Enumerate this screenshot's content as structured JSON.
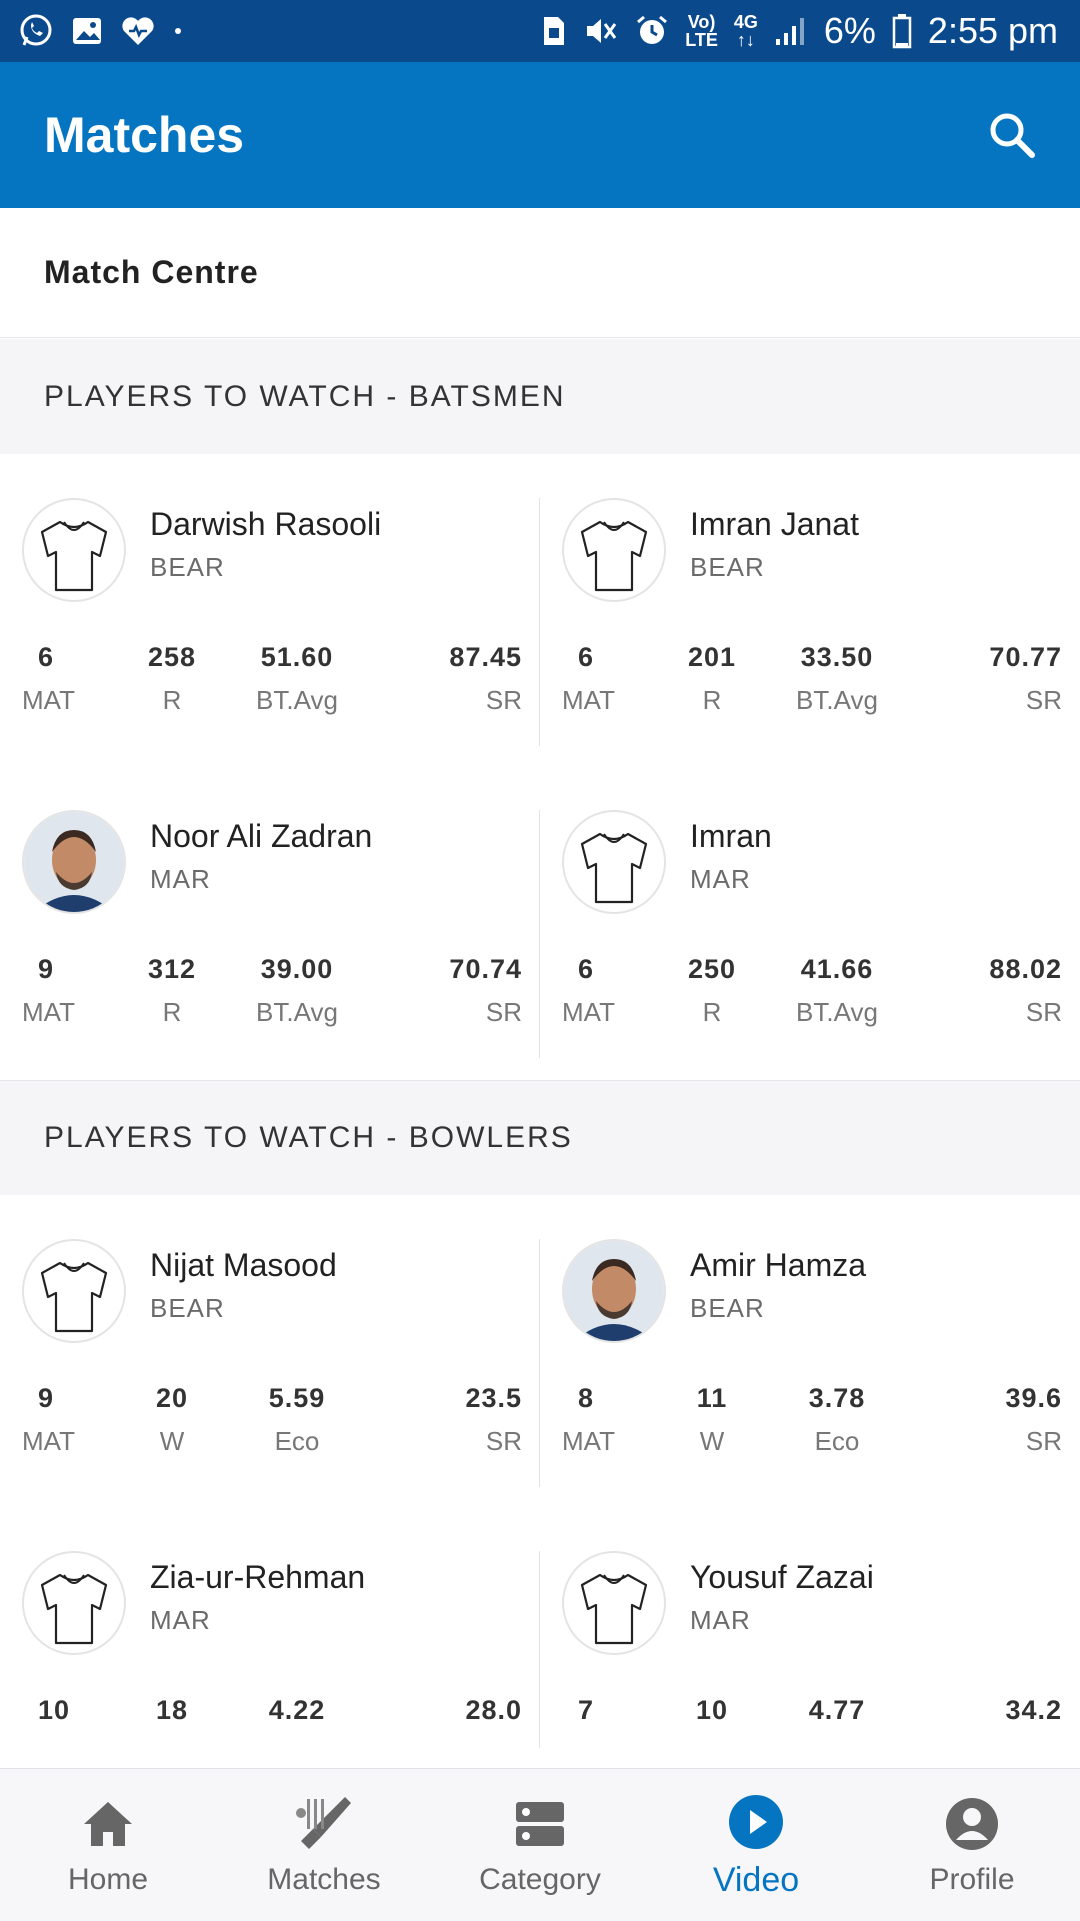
{
  "status_bar": {
    "volte_top": "Vo)",
    "volte_bottom": "LTE",
    "network_top": "4G",
    "network_bottom": "↑↓",
    "battery": "6%",
    "time": "2:55 pm"
  },
  "app_bar": {
    "title": "Matches",
    "search_icon": "search-icon"
  },
  "match_centre": {
    "label": "Match Centre"
  },
  "batsmen": {
    "heading": "PLAYERS TO WATCH - BATSMEN",
    "players": [
      {
        "name": "Darwish Rasooli",
        "team": "BEAR",
        "avatar": "jersey",
        "stats": [
          {
            "value": "6",
            "label": "MAT"
          },
          {
            "value": "258",
            "label": "R"
          },
          {
            "value": "51.60",
            "label": "BT.Avg"
          },
          {
            "value": "87.45",
            "label": "SR"
          }
        ]
      },
      {
        "name": "Imran Janat",
        "team": "BEAR",
        "avatar": "jersey",
        "stats": [
          {
            "value": "6",
            "label": "MAT"
          },
          {
            "value": "201",
            "label": "R"
          },
          {
            "value": "33.50",
            "label": "BT.Avg"
          },
          {
            "value": "70.77",
            "label": "SR"
          }
        ]
      },
      {
        "name": "Noor Ali Zadran",
        "team": "MAR",
        "avatar": "photo",
        "stats": [
          {
            "value": "9",
            "label": "MAT"
          },
          {
            "value": "312",
            "label": "R"
          },
          {
            "value": "39.00",
            "label": "BT.Avg"
          },
          {
            "value": "70.74",
            "label": "SR"
          }
        ]
      },
      {
        "name": "Imran",
        "team": "MAR",
        "avatar": "jersey",
        "stats": [
          {
            "value": "6",
            "label": "MAT"
          },
          {
            "value": "250",
            "label": "R"
          },
          {
            "value": "41.66",
            "label": "BT.Avg"
          },
          {
            "value": "88.02",
            "label": "SR"
          }
        ]
      }
    ]
  },
  "bowlers": {
    "heading": "PLAYERS TO WATCH - BOWLERS",
    "players": [
      {
        "name": "Nijat Masood",
        "team": "BEAR",
        "avatar": "jersey",
        "stats": [
          {
            "value": "9",
            "label": "MAT"
          },
          {
            "value": "20",
            "label": "W"
          },
          {
            "value": "5.59",
            "label": "Eco"
          },
          {
            "value": "23.5",
            "label": "SR"
          }
        ]
      },
      {
        "name": "Amir Hamza",
        "team": "BEAR",
        "avatar": "photo",
        "stats": [
          {
            "value": "8",
            "label": "MAT"
          },
          {
            "value": "11",
            "label": "W"
          },
          {
            "value": "3.78",
            "label": "Eco"
          },
          {
            "value": "39.6",
            "label": "SR"
          }
        ]
      },
      {
        "name": "Zia-ur-Rehman",
        "team": "MAR",
        "avatar": "jersey",
        "stats": [
          {
            "value": "10",
            "label": ""
          },
          {
            "value": "18",
            "label": ""
          },
          {
            "value": "4.22",
            "label": ""
          },
          {
            "value": "28.0",
            "label": ""
          }
        ]
      },
      {
        "name": "Yousuf Zazai",
        "team": "MAR",
        "avatar": "jersey",
        "stats": [
          {
            "value": "7",
            "label": ""
          },
          {
            "value": "10",
            "label": ""
          },
          {
            "value": "4.77",
            "label": ""
          },
          {
            "value": "34.2",
            "label": ""
          }
        ]
      }
    ]
  },
  "bottom_nav": {
    "items": [
      {
        "label": "Home",
        "icon": "home-icon"
      },
      {
        "label": "Matches",
        "icon": "cricket-bat-icon"
      },
      {
        "label": "Category",
        "icon": "category-icon"
      },
      {
        "label": "Video",
        "icon": "play-circle-icon",
        "active": true
      },
      {
        "label": "Profile",
        "icon": "profile-icon"
      }
    ]
  },
  "colors": {
    "status_bar": "#0a4a8c",
    "app_bar": "#0675c1",
    "active_nav": "#0675c1",
    "section_bg": "#f5f5f8"
  }
}
